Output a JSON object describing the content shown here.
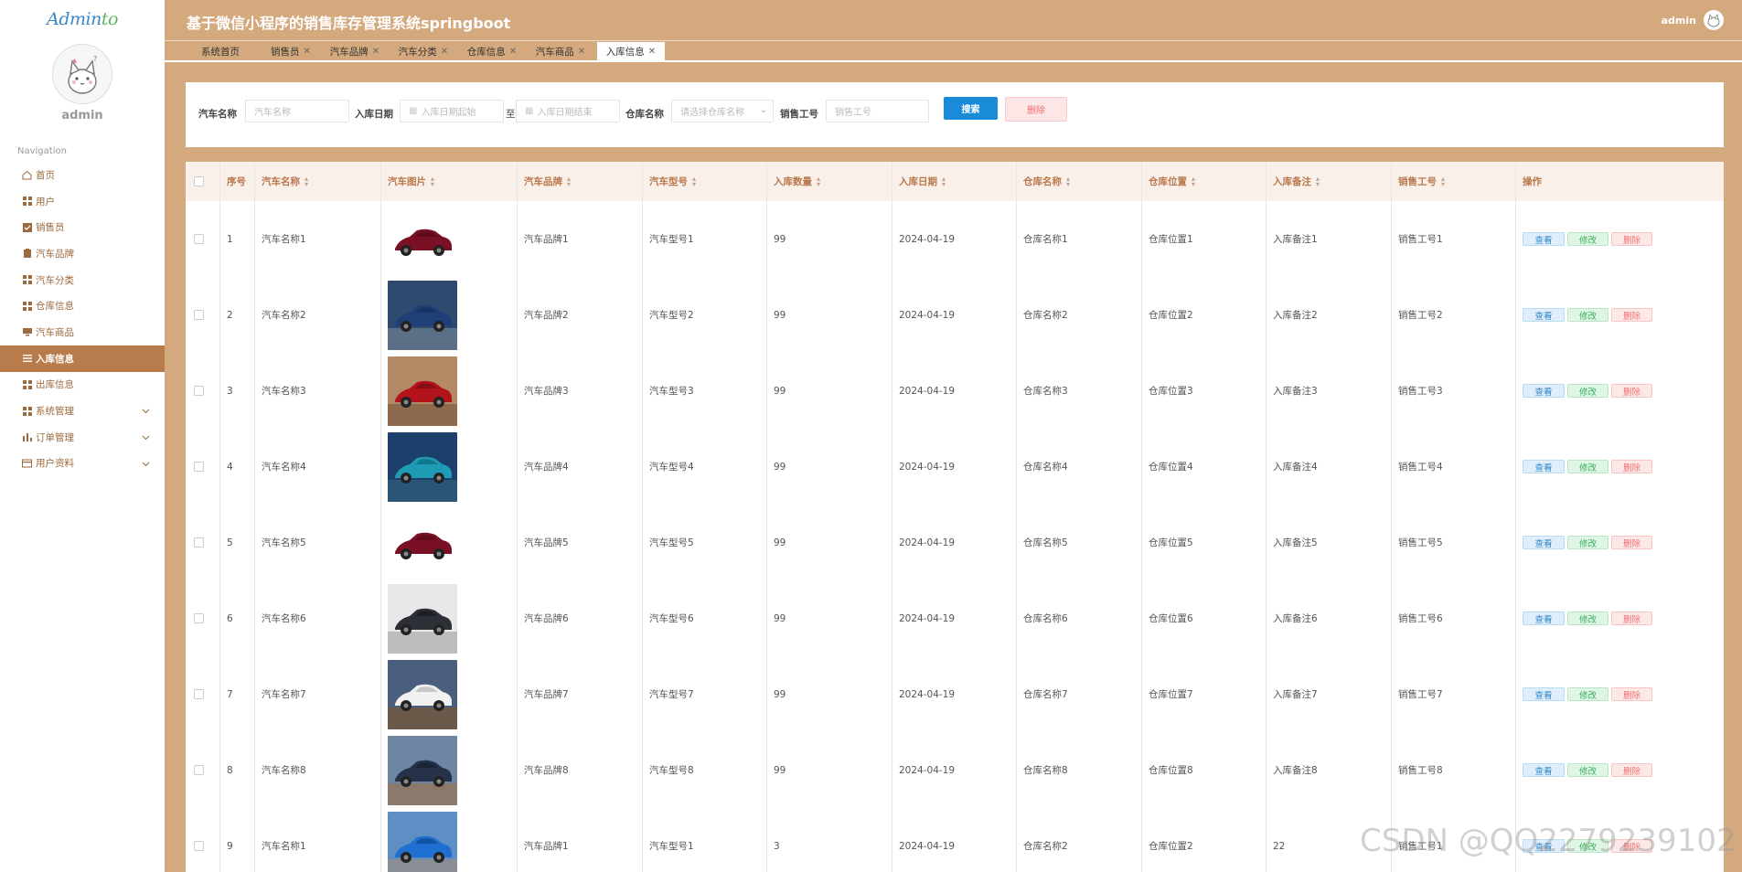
{
  "app": {
    "logo_text_part1": "Admin",
    "logo_text_part2": "to",
    "title": "基于微信小程序的销售库存管理系统springboot",
    "user": "admin"
  },
  "sidebar": {
    "user_name": "admin",
    "nav_heading": "Navigation",
    "items": [
      {
        "label": "首页",
        "icon": "home-icon"
      },
      {
        "label": "用户",
        "icon": "grid-icon"
      },
      {
        "label": "销售员",
        "icon": "check-square-icon"
      },
      {
        "label": "汽车品牌",
        "icon": "clipboard-icon"
      },
      {
        "label": "汽车分类",
        "icon": "grid-icon"
      },
      {
        "label": "仓库信息",
        "icon": "grid-icon"
      },
      {
        "label": "汽车商品",
        "icon": "monitor-icon"
      },
      {
        "label": "入库信息",
        "icon": "list-icon",
        "active": true
      },
      {
        "label": "出库信息",
        "icon": "grid-icon"
      },
      {
        "label": "系统管理",
        "icon": "grid-icon",
        "expandable": true
      },
      {
        "label": "订单管理",
        "icon": "bar-chart-icon",
        "expandable": true
      },
      {
        "label": "用户资料",
        "icon": "card-icon",
        "expandable": true
      }
    ]
  },
  "tabs": [
    {
      "label": "系统首页",
      "closable": false
    },
    {
      "label": "销售员",
      "closable": true
    },
    {
      "label": "汽车品牌",
      "closable": true
    },
    {
      "label": "汽车分类",
      "closable": true
    },
    {
      "label": "仓库信息",
      "closable": true
    },
    {
      "label": "汽车商品",
      "closable": true
    },
    {
      "label": "入库信息",
      "closable": true,
      "active": true
    }
  ],
  "search": {
    "car_name_label": "汽车名称",
    "car_name_placeholder": "汽车名称",
    "date_label": "入库日期",
    "date_start_placeholder": "入库日期起始",
    "date_sep": "至",
    "date_end_placeholder": "入库日期结束",
    "warehouse_label": "仓库名称",
    "warehouse_placeholder": "请选择仓库名称",
    "staff_label": "销售工号",
    "staff_placeholder": "销售工号",
    "search_button": "搜索",
    "delete_button": "删除"
  },
  "table": {
    "columns": [
      "序号",
      "汽车名称",
      "汽车图片",
      "汽车品牌",
      "汽车型号",
      "入库数量",
      "入库日期",
      "仓库名称",
      "仓库位置",
      "入库备注",
      "销售工号",
      "操作"
    ],
    "actions": {
      "view": "查看",
      "edit": "修改",
      "delete": "删除"
    },
    "rows": [
      {
        "no": "1",
        "name": "汽车名称1",
        "image": "red-sedan",
        "brand": "汽车品牌1",
        "model": "汽车型号1",
        "qty": "99",
        "date": "2024-04-19",
        "warehouse": "仓库名称1",
        "location": "仓库位置1",
        "note": "入库备注1",
        "staff": "销售工号1"
      },
      {
        "no": "2",
        "name": "汽车名称2",
        "image": "blue-luxury",
        "brand": "汽车品牌2",
        "model": "汽车型号2",
        "qty": "99",
        "date": "2024-04-19",
        "warehouse": "仓库名称2",
        "location": "仓库位置2",
        "note": "入库备注2",
        "staff": "销售工号2"
      },
      {
        "no": "3",
        "name": "汽车名称3",
        "image": "red-coupe-canyon",
        "brand": "汽车品牌3",
        "model": "汽车型号3",
        "qty": "99",
        "date": "2024-04-19",
        "warehouse": "仓库名称3",
        "location": "仓库位置3",
        "note": "入库备注3",
        "staff": "销售工号3"
      },
      {
        "no": "4",
        "name": "汽车名称4",
        "image": "teal-suv",
        "brand": "汽车品牌4",
        "model": "汽车型号4",
        "qty": "99",
        "date": "2024-04-19",
        "warehouse": "仓库名称4",
        "location": "仓库位置4",
        "note": "入库备注4",
        "staff": "销售工号4"
      },
      {
        "no": "5",
        "name": "汽车名称5",
        "image": "red-sedan",
        "brand": "汽车品牌5",
        "model": "汽车型号5",
        "qty": "99",
        "date": "2024-04-19",
        "warehouse": "仓库名称5",
        "location": "仓库位置5",
        "note": "入库备注5",
        "staff": "销售工号5"
      },
      {
        "no": "6",
        "name": "汽车名称6",
        "image": "dark-suv",
        "brand": "汽车品牌6",
        "model": "汽车型号6",
        "qty": "99",
        "date": "2024-04-19",
        "warehouse": "仓库名称6",
        "location": "仓库位置6",
        "note": "入库备注6",
        "staff": "销售工号6"
      },
      {
        "no": "7",
        "name": "汽车名称7",
        "image": "white-gullwing",
        "brand": "汽车品牌7",
        "model": "汽车型号7",
        "qty": "99",
        "date": "2024-04-19",
        "warehouse": "仓库名称7",
        "location": "仓库位置7",
        "note": "入库备注7",
        "staff": "销售工号7"
      },
      {
        "no": "8",
        "name": "汽车名称8",
        "image": "dark-suv-mountain",
        "brand": "汽车品牌8",
        "model": "汽车型号8",
        "qty": "99",
        "date": "2024-04-19",
        "warehouse": "仓库名称8",
        "location": "仓库位置8",
        "note": "入库备注8",
        "staff": "销售工号8"
      },
      {
        "no": "9",
        "name": "汽车名称1",
        "image": "blue-hatch",
        "brand": "汽车品牌1",
        "model": "汽车型号1",
        "qty": "3",
        "date": "2024-04-19",
        "warehouse": "仓库名称2",
        "location": "仓库位置2",
        "note": "22",
        "staff": "销售工号1"
      }
    ]
  },
  "watermark": "CSDN @QQ2279239102",
  "colors": {
    "header_bg": "#d4a97e",
    "sidebar_active_bg": "#b87c4c",
    "accent_text": "#b9784c",
    "search_button": "#1a8bd9",
    "danger": "#ef6f6f",
    "success": "#3aae5c"
  }
}
